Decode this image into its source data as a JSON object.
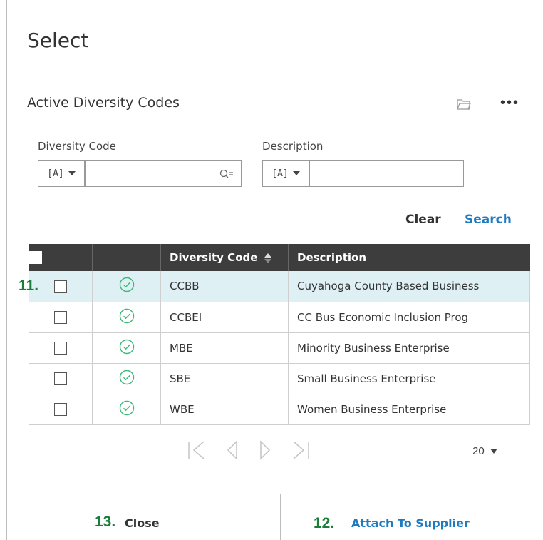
{
  "dialog": {
    "title": "Select"
  },
  "section": {
    "title": "Active Diversity Codes"
  },
  "filters": {
    "code_label": "Diversity Code",
    "code_value": "",
    "code_operator": "[A]",
    "desc_label": "Description",
    "desc_value": "",
    "desc_operator": "[A]"
  },
  "actions": {
    "clear": "Clear",
    "search": "Search"
  },
  "table": {
    "columns": [
      "",
      "",
      "Diversity Code",
      "Description"
    ],
    "rows": [
      {
        "code": "CCBB",
        "description": "Cuyahoga County Based Business",
        "selected_highlight": true
      },
      {
        "code": "CCBEI",
        "description": "CC Bus Economic Inclusion Prog",
        "selected_highlight": false
      },
      {
        "code": "MBE",
        "description": "Minority Business Enterprise",
        "selected_highlight": false
      },
      {
        "code": "SBE",
        "description": "Small Business Enterprise",
        "selected_highlight": false
      },
      {
        "code": "WBE",
        "description": "Women Business Enterprise",
        "selected_highlight": false
      }
    ]
  },
  "pager": {
    "page_size": "20"
  },
  "annotations": {
    "row_marker": "11.",
    "attach_marker": "12.",
    "close_marker": "13."
  },
  "footer": {
    "close": "Close",
    "attach": "Attach To Supplier"
  },
  "colors": {
    "accent": "#1f7bbf",
    "annotation": "#1a7d3a",
    "header_bg": "#3d3d3d",
    "row_highlight": "#dff0f5",
    "status_green": "#3cb878"
  },
  "icons": {
    "folder": "folder-icon",
    "more": "more-icon",
    "lookup": "lookup-icon",
    "status": "check-circle-icon"
  }
}
